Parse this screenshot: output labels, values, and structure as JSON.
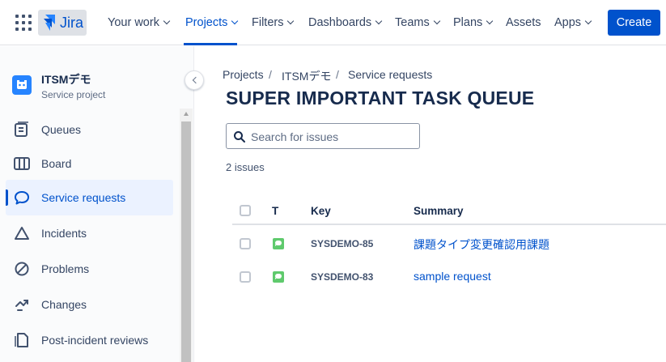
{
  "nav": {
    "logo_text": "Jira",
    "items": [
      {
        "label": "Your work"
      },
      {
        "label": "Projects"
      },
      {
        "label": "Filters"
      },
      {
        "label": "Dashboards"
      },
      {
        "label": "Teams"
      },
      {
        "label": "Plans"
      },
      {
        "label": "Assets"
      },
      {
        "label": "Apps"
      }
    ],
    "active_item": "Projects",
    "create_label": "Create",
    "accent_color": "#0052CC"
  },
  "sidebar": {
    "project_name": "ITSMデモ",
    "project_type": "Service project",
    "items": [
      {
        "label": "Queues",
        "icon": "queues-icon"
      },
      {
        "label": "Board",
        "icon": "board-icon"
      },
      {
        "label": "Service requests",
        "icon": "chat-bubble-icon",
        "selected": true
      },
      {
        "label": "Incidents",
        "icon": "warning-triangle-icon"
      },
      {
        "label": "Problems",
        "icon": "prohibited-icon"
      },
      {
        "label": "Changes",
        "icon": "changes-icon"
      },
      {
        "label": "Post-incident reviews",
        "icon": "document-icon"
      }
    ]
  },
  "breadcrumb": [
    "Projects",
    "ITSMデモ",
    "Service requests"
  ],
  "page_title": "SUPER IMPORTANT TASK QUEUE",
  "search": {
    "placeholder": "Search for issues",
    "value": ""
  },
  "issue_count": "2 issues",
  "table": {
    "columns": {
      "type": "T",
      "key": "Key",
      "summary": "Summary"
    },
    "rows": [
      {
        "type": "service-request-icon",
        "key": "SYSDEMO-85",
        "summary": "課題タイプ変更確認用課題"
      },
      {
        "type": "service-request-icon",
        "key": "SYSDEMO-83",
        "summary": "sample request"
      }
    ]
  }
}
